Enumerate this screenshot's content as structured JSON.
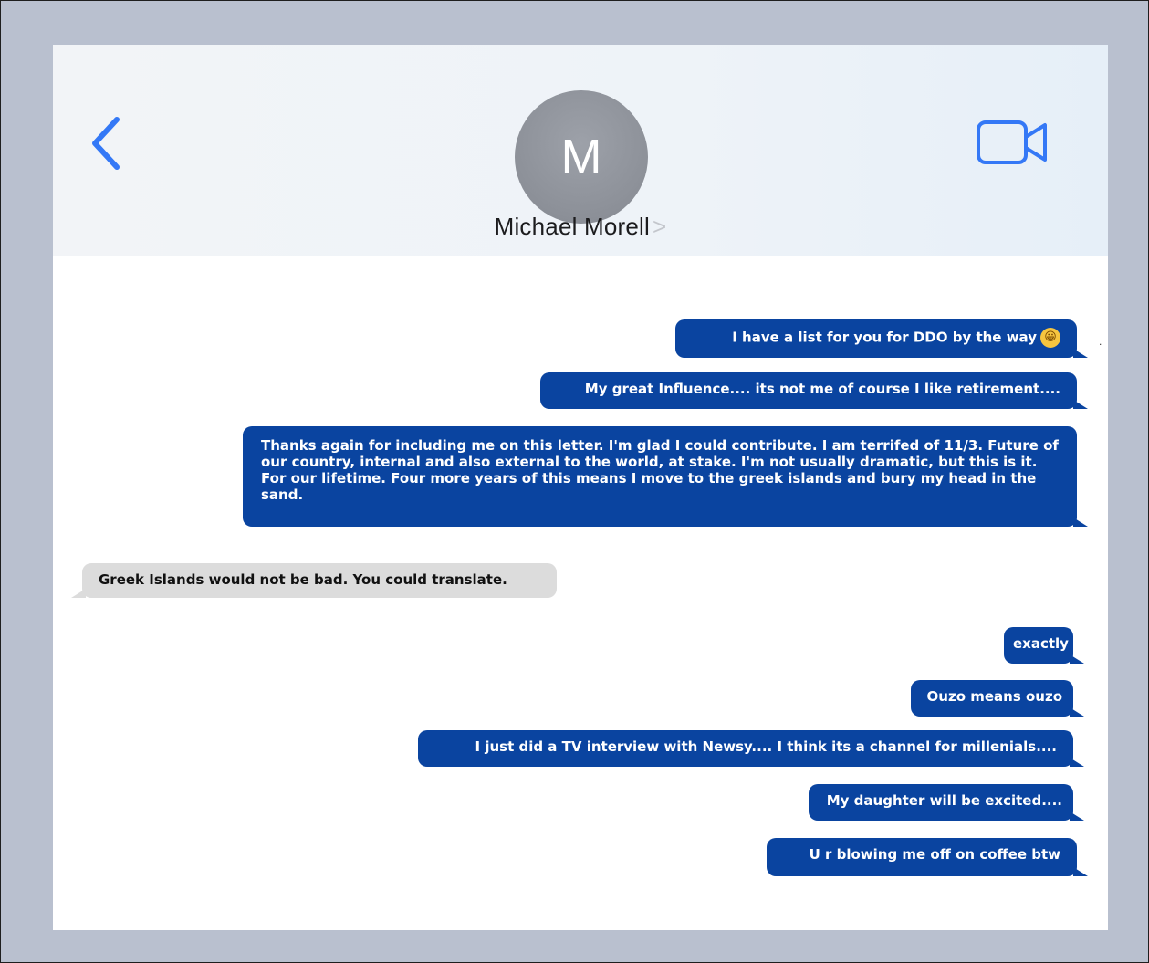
{
  "header": {
    "avatar_initial": "M",
    "contact_name": "Michael Morell",
    "name_chevron": ">",
    "back_icon": "chevron-left-icon",
    "video_icon": "video-camera-icon",
    "accent_color": "#3478f6"
  },
  "messages": [
    {
      "direction": "out",
      "text": "I have a list for you for DDO by the way",
      "emoji": "😀"
    },
    {
      "direction": "out",
      "text": "My great Influence.... its not me of course I like retirement...."
    },
    {
      "direction": "out",
      "text": "Thanks again for including me on this letter. I'm glad I could contribute. I am terrifed of 11/3. Future of our country, internal and also external to the world, at stake. I'm not usually dramatic, but this is it. For our lifetime. Four more years of this means I move to the greek islands and bury my head in the sand."
    },
    {
      "direction": "in",
      "text": "Greek Islands would not be bad. You could translate."
    },
    {
      "direction": "out",
      "text": "exactly"
    },
    {
      "direction": "out",
      "text": "Ouzo means ouzo"
    },
    {
      "direction": "out",
      "text": "I just did a TV interview with Newsy.... I think its a channel for millenials...."
    },
    {
      "direction": "out",
      "text": "My daughter will be excited...."
    },
    {
      "direction": "out",
      "text": "U r blowing me off on coffee btw"
    }
  ],
  "colors": {
    "outgoing_bubble": "#0a44a0",
    "incoming_bubble": "#dcdcdc",
    "page_background": "#b9c0cf"
  }
}
